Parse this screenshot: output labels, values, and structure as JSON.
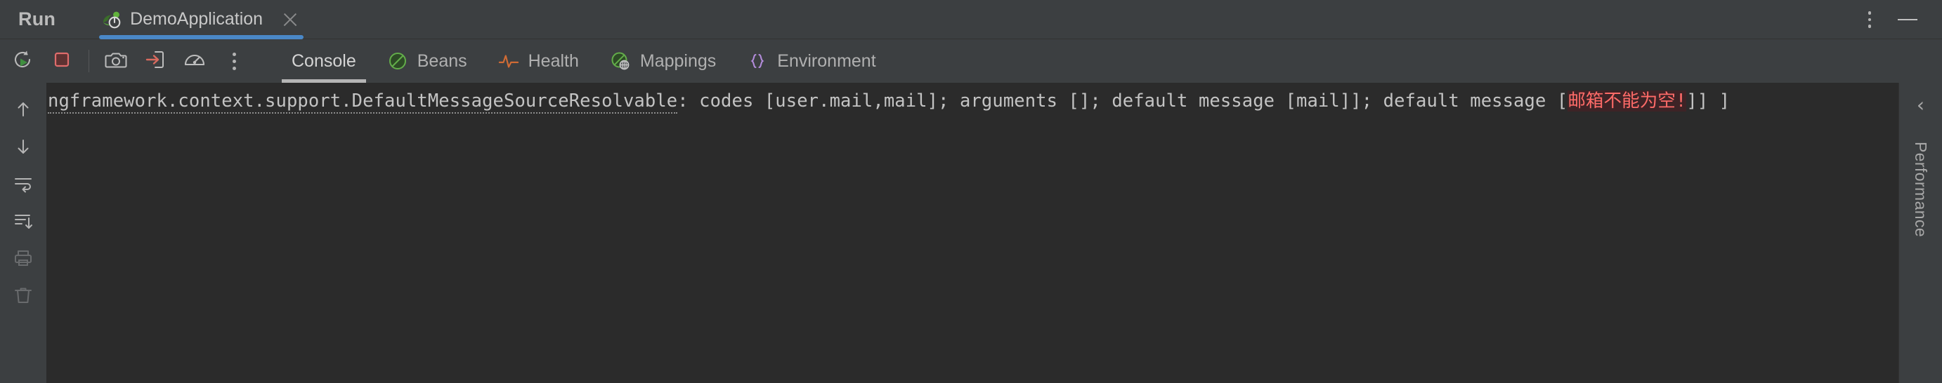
{
  "window": {
    "title": "Run",
    "controls": {
      "more_label": "more-options",
      "minimize_label": "minimize"
    }
  },
  "run_tabs": [
    {
      "label": "DemoApplication",
      "icon": "spring-boot-icon",
      "close_label": "close",
      "active": true
    }
  ],
  "toolbar": {
    "buttons": [
      {
        "name": "rerun-button",
        "icon": "rerun-icon",
        "tooltip": "Rerun"
      },
      {
        "name": "stop-button",
        "icon": "stop-icon",
        "tooltip": "Stop"
      },
      {
        "name": "screenshot-button",
        "icon": "camera-icon",
        "tooltip": "Screenshot"
      },
      {
        "name": "export-button",
        "icon": "export-arrow-icon",
        "tooltip": "Export"
      },
      {
        "name": "profiler-button",
        "icon": "gauge-icon",
        "tooltip": "Profiler"
      },
      {
        "name": "more-button",
        "icon": "kebab-menu-icon",
        "tooltip": "More"
      }
    ]
  },
  "view_tabs": [
    {
      "label": "Console",
      "icon": "console-icon",
      "active": true
    },
    {
      "label": "Beans",
      "icon": "beans-icon",
      "active": false
    },
    {
      "label": "Health",
      "icon": "health-pulse-icon",
      "active": false
    },
    {
      "label": "Mappings",
      "icon": "mappings-globe-icon",
      "active": false
    },
    {
      "label": "Environment",
      "icon": "braces-icon",
      "active": false
    }
  ],
  "gutter": {
    "buttons": [
      {
        "name": "scroll-up-button",
        "icon": "arrow-up-icon",
        "disabled": false
      },
      {
        "name": "scroll-down-button",
        "icon": "arrow-down-icon",
        "disabled": false
      },
      {
        "name": "soft-wrap-button",
        "icon": "soft-wrap-icon",
        "disabled": false
      },
      {
        "name": "scroll-to-end-button",
        "icon": "scroll-to-end-icon",
        "disabled": false
      },
      {
        "name": "print-button",
        "icon": "printer-icon",
        "disabled": true
      },
      {
        "name": "clear-all-button",
        "icon": "trash-icon",
        "disabled": true
      }
    ]
  },
  "console": {
    "line": {
      "link_text": "ngframework.context.support.DefaultMessageSourceResolvable",
      "mid_text": ": codes [user.mail,mail]; arguments []; default message [mail]]; default message [",
      "error_text": "邮箱不能为空!",
      "tail_text": "]] ]"
    }
  },
  "right_rail": {
    "collapse_icon": "chevron-left-icon",
    "collapse_glyph": "‹",
    "label": "Performance"
  },
  "colors": {
    "bg_chrome": "#3c3f41",
    "bg_console": "#2b2b2b",
    "accent_tab": "#4a88c7",
    "accent_tab_active": "#b5b5b5",
    "text_primary": "#c8c8c8",
    "text_secondary": "#b0b0b0",
    "error_fg": "#ff6b68",
    "error_bg": "#3d2326",
    "spring_green": "#57a93a",
    "health_orange": "#cf6b35",
    "braces_purple": "#b38cdb",
    "stop_red": "#d9534f"
  }
}
